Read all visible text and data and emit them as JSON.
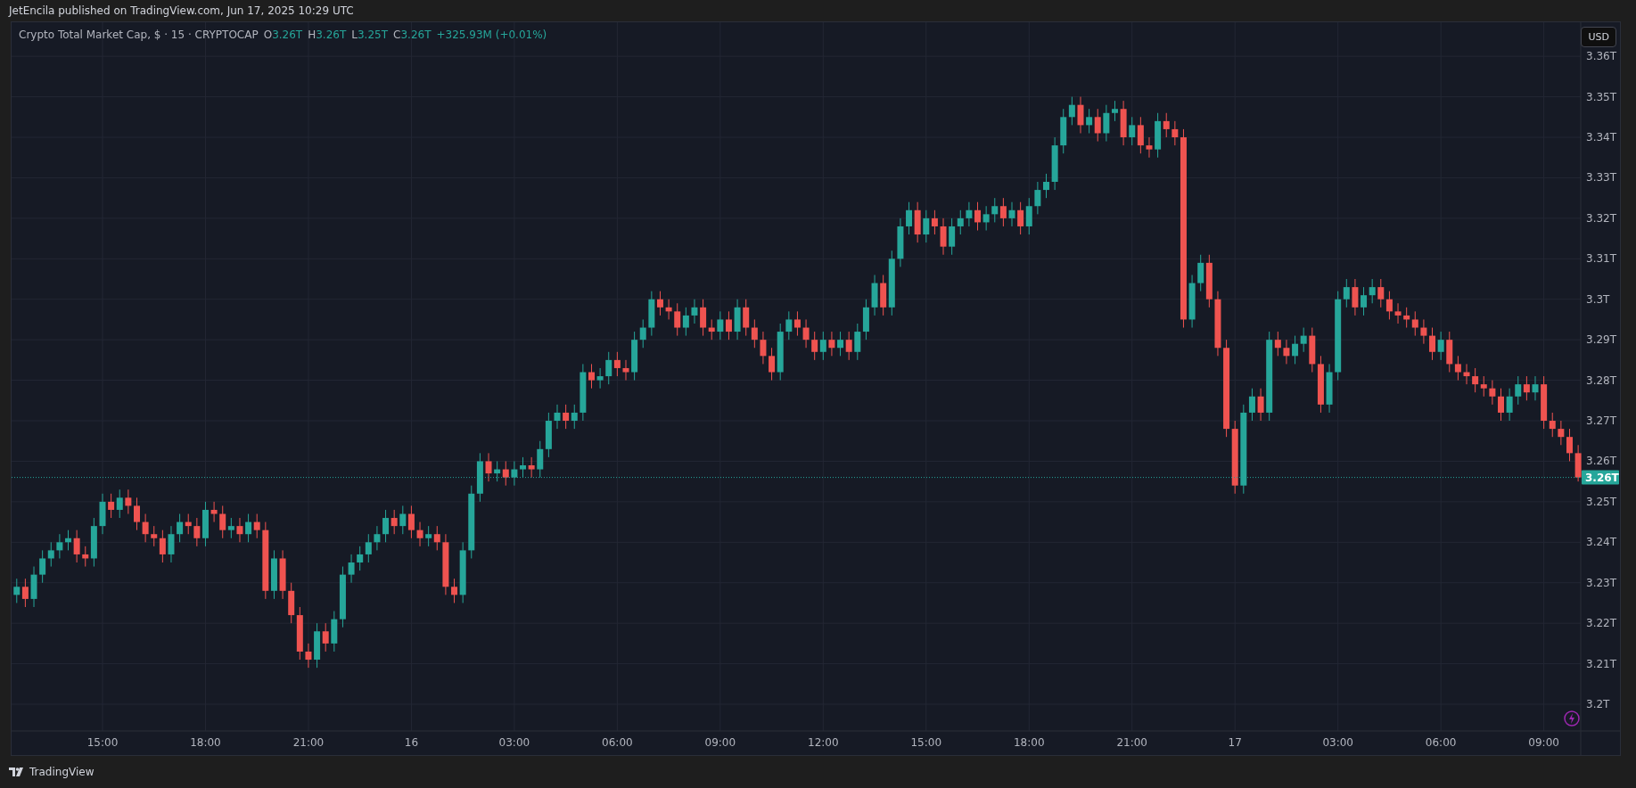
{
  "header": {
    "text": "JetEncila published on TradingView.com, Jun 17, 2025 10:29 UTC"
  },
  "legend": {
    "title": "Crypto Total Market Cap, $ · 15 · CRYPTOCAP",
    "ohlc": [
      {
        "label": "O",
        "value": "3.26T"
      },
      {
        "label": "H",
        "value": "3.26T"
      },
      {
        "label": "L",
        "value": "3.25T"
      },
      {
        "label": "C",
        "value": "3.26T"
      }
    ],
    "change": "+325.93M (+0.01%)"
  },
  "currency_button": "USD",
  "chart_data": {
    "type": "candlestick",
    "grid": true,
    "ylim": [
      3.1934,
      3.3684
    ],
    "yticks": [
      {
        "value": 3.36,
        "label": "3.36T"
      },
      {
        "value": 3.35,
        "label": "3.35T"
      },
      {
        "value": 3.34,
        "label": "3.34T"
      },
      {
        "value": 3.33,
        "label": "3.33T"
      },
      {
        "value": 3.32,
        "label": "3.32T"
      },
      {
        "value": 3.31,
        "label": "3.31T"
      },
      {
        "value": 3.3,
        "label": "3.3T"
      },
      {
        "value": 3.29,
        "label": "3.29T"
      },
      {
        "value": 3.28,
        "label": "3.28T"
      },
      {
        "value": 3.27,
        "label": "3.27T"
      },
      {
        "value": 3.26,
        "label": "3.26T"
      },
      {
        "value": 3.25,
        "label": "3.25T"
      },
      {
        "value": 3.24,
        "label": "3.24T"
      },
      {
        "value": 3.23,
        "label": "3.23T"
      },
      {
        "value": 3.22,
        "label": "3.22T"
      },
      {
        "value": 3.21,
        "label": "3.21T"
      },
      {
        "value": 3.2,
        "label": "3.2T"
      }
    ],
    "categories": [
      null,
      null,
      null,
      null,
      null,
      null,
      null,
      null,
      null,
      null,
      "15:00",
      null,
      null,
      null,
      null,
      null,
      null,
      null,
      null,
      null,
      null,
      null,
      "18:00",
      null,
      null,
      null,
      null,
      null,
      null,
      null,
      null,
      null,
      null,
      null,
      "21:00",
      null,
      null,
      null,
      null,
      null,
      null,
      null,
      null,
      null,
      null,
      null,
      "16",
      null,
      null,
      null,
      null,
      null,
      null,
      null,
      null,
      null,
      null,
      null,
      "03:00",
      null,
      null,
      null,
      null,
      null,
      null,
      null,
      null,
      null,
      null,
      null,
      "06:00",
      null,
      null,
      null,
      null,
      null,
      null,
      null,
      null,
      null,
      null,
      null,
      "09:00",
      null,
      null,
      null,
      null,
      null,
      null,
      null,
      null,
      null,
      null,
      null,
      "12:00",
      null,
      null,
      null,
      null,
      null,
      null,
      null,
      null,
      null,
      null,
      null,
      "15:00",
      null,
      null,
      null,
      null,
      null,
      null,
      null,
      null,
      null,
      null,
      null,
      "18:00",
      null,
      null,
      null,
      null,
      null,
      null,
      null,
      null,
      null,
      null,
      null,
      "21:00",
      null,
      null,
      null,
      null,
      null,
      null,
      null,
      null,
      null,
      null,
      null,
      "17",
      null,
      null,
      null,
      null,
      null,
      null,
      null,
      null,
      null,
      null,
      null,
      "03:00",
      null,
      null,
      null,
      null,
      null,
      null,
      null,
      null,
      null,
      null,
      null,
      "06:00",
      null,
      null,
      null,
      null,
      null,
      null,
      null,
      null,
      null,
      null,
      null,
      "09:00",
      null,
      null,
      null,
      null
    ],
    "ref_lines": [
      {
        "axis": "y",
        "value": 3.256,
        "color": "#26a69a",
        "label": "3.26T"
      }
    ],
    "ohlc": [
      [
        3.227,
        3.231,
        3.225,
        3.229
      ],
      [
        3.229,
        3.231,
        3.224,
        3.226
      ],
      [
        3.226,
        3.234,
        3.224,
        3.232
      ],
      [
        3.232,
        3.238,
        3.23,
        3.236
      ],
      [
        3.236,
        3.24,
        3.234,
        3.238
      ],
      [
        3.238,
        3.242,
        3.236,
        3.24
      ],
      [
        3.24,
        3.243,
        3.238,
        3.241
      ],
      [
        3.241,
        3.243,
        3.235,
        3.237
      ],
      [
        3.237,
        3.239,
        3.234,
        3.236
      ],
      [
        3.236,
        3.246,
        3.234,
        3.244
      ],
      [
        3.244,
        3.252,
        3.242,
        3.25
      ],
      [
        3.25,
        3.252,
        3.246,
        3.248
      ],
      [
        3.248,
        3.253,
        3.246,
        3.251
      ],
      [
        3.251,
        3.253,
        3.247,
        3.249
      ],
      [
        3.249,
        3.251,
        3.243,
        3.245
      ],
      [
        3.245,
        3.247,
        3.24,
        3.242
      ],
      [
        3.242,
        3.244,
        3.239,
        3.241
      ],
      [
        3.241,
        3.243,
        3.235,
        3.237
      ],
      [
        3.237,
        3.244,
        3.235,
        3.242
      ],
      [
        3.242,
        3.247,
        3.24,
        3.245
      ],
      [
        3.245,
        3.247,
        3.242,
        3.244
      ],
      [
        3.244,
        3.246,
        3.239,
        3.241
      ],
      [
        3.241,
        3.25,
        3.239,
        3.248
      ],
      [
        3.248,
        3.25,
        3.245,
        3.247
      ],
      [
        3.247,
        3.249,
        3.241,
        3.243
      ],
      [
        3.243,
        3.246,
        3.241,
        3.244
      ],
      [
        3.244,
        3.246,
        3.24,
        3.242
      ],
      [
        3.242,
        3.247,
        3.24,
        3.245
      ],
      [
        3.245,
        3.247,
        3.241,
        3.243
      ],
      [
        3.243,
        3.245,
        3.226,
        3.228
      ],
      [
        3.228,
        3.238,
        3.226,
        3.236
      ],
      [
        3.236,
        3.238,
        3.226,
        3.228
      ],
      [
        3.228,
        3.23,
        3.22,
        3.222
      ],
      [
        3.222,
        3.224,
        3.211,
        3.213
      ],
      [
        3.213,
        3.215,
        3.209,
        3.211
      ],
      [
        3.211,
        3.22,
        3.209,
        3.218
      ],
      [
        3.218,
        3.22,
        3.213,
        3.215
      ],
      [
        3.215,
        3.223,
        3.213,
        3.221
      ],
      [
        3.221,
        3.234,
        3.219,
        3.232
      ],
      [
        3.232,
        3.237,
        3.23,
        3.235
      ],
      [
        3.235,
        3.239,
        3.233,
        3.237
      ],
      [
        3.237,
        3.242,
        3.235,
        3.24
      ],
      [
        3.24,
        3.244,
        3.238,
        3.242
      ],
      [
        3.242,
        3.248,
        3.24,
        3.246
      ],
      [
        3.246,
        3.248,
        3.242,
        3.244
      ],
      [
        3.244,
        3.249,
        3.242,
        3.247
      ],
      [
        3.247,
        3.249,
        3.241,
        3.243
      ],
      [
        3.243,
        3.245,
        3.239,
        3.241
      ],
      [
        3.241,
        3.244,
        3.239,
        3.242
      ],
      [
        3.242,
        3.244,
        3.238,
        3.24
      ],
      [
        3.24,
        3.242,
        3.227,
        3.229
      ],
      [
        3.229,
        3.231,
        3.225,
        3.227
      ],
      [
        3.227,
        3.24,
        3.225,
        3.238
      ],
      [
        3.238,
        3.254,
        3.236,
        3.252
      ],
      [
        3.252,
        3.262,
        3.25,
        3.26
      ],
      [
        3.26,
        3.262,
        3.255,
        3.257
      ],
      [
        3.257,
        3.26,
        3.255,
        3.258
      ],
      [
        3.258,
        3.26,
        3.254,
        3.256
      ],
      [
        3.256,
        3.26,
        3.254,
        3.258
      ],
      [
        3.258,
        3.261,
        3.256,
        3.259
      ],
      [
        3.259,
        3.261,
        3.256,
        3.258
      ],
      [
        3.258,
        3.265,
        3.256,
        3.263
      ],
      [
        3.263,
        3.272,
        3.261,
        3.27
      ],
      [
        3.27,
        3.274,
        3.268,
        3.272
      ],
      [
        3.272,
        3.274,
        3.268,
        3.27
      ],
      [
        3.27,
        3.274,
        3.268,
        3.272
      ],
      [
        3.272,
        3.284,
        3.27,
        3.282
      ],
      [
        3.282,
        3.284,
        3.278,
        3.28
      ],
      [
        3.28,
        3.283,
        3.278,
        3.281
      ],
      [
        3.281,
        3.287,
        3.279,
        3.285
      ],
      [
        3.285,
        3.287,
        3.281,
        3.283
      ],
      [
        3.283,
        3.285,
        3.28,
        3.282
      ],
      [
        3.282,
        3.292,
        3.28,
        3.29
      ],
      [
        3.29,
        3.295,
        3.288,
        3.293
      ],
      [
        3.293,
        3.302,
        3.291,
        3.3
      ],
      [
        3.3,
        3.302,
        3.296,
        3.298
      ],
      [
        3.298,
        3.3,
        3.295,
        3.297
      ],
      [
        3.297,
        3.299,
        3.291,
        3.293
      ],
      [
        3.293,
        3.298,
        3.291,
        3.296
      ],
      [
        3.296,
        3.3,
        3.294,
        3.298
      ],
      [
        3.298,
        3.3,
        3.291,
        3.293
      ],
      [
        3.293,
        3.295,
        3.29,
        3.292
      ],
      [
        3.292,
        3.297,
        3.29,
        3.295
      ],
      [
        3.295,
        3.297,
        3.29,
        3.292
      ],
      [
        3.292,
        3.3,
        3.29,
        3.298
      ],
      [
        3.298,
        3.3,
        3.291,
        3.293
      ],
      [
        3.293,
        3.295,
        3.288,
        3.29
      ],
      [
        3.29,
        3.292,
        3.284,
        3.286
      ],
      [
        3.286,
        3.288,
        3.28,
        3.282
      ],
      [
        3.282,
        3.294,
        3.28,
        3.292
      ],
      [
        3.292,
        3.297,
        3.29,
        3.295
      ],
      [
        3.295,
        3.297,
        3.291,
        3.293
      ],
      [
        3.293,
        3.295,
        3.288,
        3.29
      ],
      [
        3.29,
        3.292,
        3.285,
        3.287
      ],
      [
        3.287,
        3.292,
        3.285,
        3.29
      ],
      [
        3.29,
        3.292,
        3.286,
        3.288
      ],
      [
        3.288,
        3.292,
        3.286,
        3.29
      ],
      [
        3.29,
        3.292,
        3.285,
        3.287
      ],
      [
        3.287,
        3.294,
        3.285,
        3.292
      ],
      [
        3.292,
        3.3,
        3.29,
        3.298
      ],
      [
        3.298,
        3.306,
        3.296,
        3.304
      ],
      [
        3.304,
        3.306,
        3.296,
        3.298
      ],
      [
        3.298,
        3.312,
        3.296,
        3.31
      ],
      [
        3.31,
        3.32,
        3.308,
        3.318
      ],
      [
        3.318,
        3.324,
        3.316,
        3.322
      ],
      [
        3.322,
        3.324,
        3.314,
        3.316
      ],
      [
        3.316,
        3.322,
        3.314,
        3.32
      ],
      [
        3.32,
        3.322,
        3.316,
        3.318
      ],
      [
        3.318,
        3.32,
        3.311,
        3.313
      ],
      [
        3.313,
        3.32,
        3.311,
        3.318
      ],
      [
        3.318,
        3.322,
        3.316,
        3.32
      ],
      [
        3.32,
        3.324,
        3.318,
        3.322
      ],
      [
        3.322,
        3.324,
        3.317,
        3.319
      ],
      [
        3.319,
        3.323,
        3.317,
        3.321
      ],
      [
        3.321,
        3.325,
        3.319,
        3.323
      ],
      [
        3.323,
        3.325,
        3.318,
        3.32
      ],
      [
        3.32,
        3.324,
        3.318,
        3.322
      ],
      [
        3.322,
        3.324,
        3.316,
        3.318
      ],
      [
        3.318,
        3.325,
        3.316,
        3.323
      ],
      [
        3.323,
        3.329,
        3.321,
        3.327
      ],
      [
        3.327,
        3.331,
        3.325,
        3.329
      ],
      [
        3.329,
        3.34,
        3.327,
        3.338
      ],
      [
        3.338,
        3.347,
        3.336,
        3.345
      ],
      [
        3.345,
        3.35,
        3.343,
        3.348
      ],
      [
        3.348,
        3.35,
        3.341,
        3.343
      ],
      [
        3.343,
        3.347,
        3.341,
        3.345
      ],
      [
        3.345,
        3.347,
        3.339,
        3.341
      ],
      [
        3.341,
        3.348,
        3.339,
        3.346
      ],
      [
        3.346,
        3.349,
        3.344,
        3.347
      ],
      [
        3.347,
        3.349,
        3.338,
        3.34
      ],
      [
        3.34,
        3.345,
        3.338,
        3.343
      ],
      [
        3.343,
        3.345,
        3.336,
        3.338
      ],
      [
        3.338,
        3.34,
        3.335,
        3.337
      ],
      [
        3.337,
        3.346,
        3.335,
        3.344
      ],
      [
        3.344,
        3.346,
        3.34,
        3.342
      ],
      [
        3.342,
        3.344,
        3.338,
        3.34
      ],
      [
        3.34,
        3.342,
        3.293,
        3.295
      ],
      [
        3.295,
        3.306,
        3.293,
        3.304
      ],
      [
        3.304,
        3.311,
        3.302,
        3.309
      ],
      [
        3.309,
        3.311,
        3.298,
        3.3
      ],
      [
        3.3,
        3.302,
        3.286,
        3.288
      ],
      [
        3.288,
        3.29,
        3.266,
        3.268
      ],
      [
        3.268,
        3.27,
        3.252,
        3.254
      ],
      [
        3.254,
        3.274,
        3.252,
        3.272
      ],
      [
        3.272,
        3.278,
        3.27,
        3.276
      ],
      [
        3.276,
        3.278,
        3.27,
        3.272
      ],
      [
        3.272,
        3.292,
        3.27,
        3.29
      ],
      [
        3.29,
        3.292,
        3.286,
        3.288
      ],
      [
        3.288,
        3.29,
        3.284,
        3.286
      ],
      [
        3.286,
        3.291,
        3.284,
        3.289
      ],
      [
        3.289,
        3.293,
        3.287,
        3.291
      ],
      [
        3.291,
        3.293,
        3.282,
        3.284
      ],
      [
        3.284,
        3.286,
        3.272,
        3.274
      ],
      [
        3.274,
        3.284,
        3.272,
        3.282
      ],
      [
        3.282,
        3.302,
        3.28,
        3.3
      ],
      [
        3.3,
        3.305,
        3.298,
        3.303
      ],
      [
        3.303,
        3.305,
        3.296,
        3.298
      ],
      [
        3.298,
        3.303,
        3.296,
        3.301
      ],
      [
        3.301,
        3.305,
        3.299,
        3.303
      ],
      [
        3.303,
        3.305,
        3.298,
        3.3
      ],
      [
        3.3,
        3.302,
        3.295,
        3.297
      ],
      [
        3.297,
        3.299,
        3.294,
        3.296
      ],
      [
        3.296,
        3.298,
        3.293,
        3.295
      ],
      [
        3.295,
        3.297,
        3.291,
        3.293
      ],
      [
        3.293,
        3.295,
        3.289,
        3.291
      ],
      [
        3.291,
        3.293,
        3.285,
        3.287
      ],
      [
        3.287,
        3.292,
        3.285,
        3.29
      ],
      [
        3.29,
        3.292,
        3.282,
        3.284
      ],
      [
        3.284,
        3.286,
        3.28,
        3.282
      ],
      [
        3.282,
        3.284,
        3.279,
        3.281
      ],
      [
        3.281,
        3.283,
        3.277,
        3.279
      ],
      [
        3.279,
        3.281,
        3.276,
        3.278
      ],
      [
        3.278,
        3.28,
        3.274,
        3.276
      ],
      [
        3.276,
        3.278,
        3.27,
        3.272
      ],
      [
        3.272,
        3.278,
        3.27,
        3.276
      ],
      [
        3.276,
        3.281,
        3.274,
        3.279
      ],
      [
        3.279,
        3.281,
        3.275,
        3.277
      ],
      [
        3.277,
        3.281,
        3.275,
        3.279
      ],
      [
        3.279,
        3.281,
        3.268,
        3.27
      ],
      [
        3.27,
        3.272,
        3.266,
        3.268
      ],
      [
        3.268,
        3.27,
        3.264,
        3.266
      ],
      [
        3.266,
        3.268,
        3.26,
        3.262
      ],
      [
        3.262,
        3.264,
        3.255,
        3.256
      ]
    ]
  },
  "footer": {
    "brand": "TradingView"
  }
}
